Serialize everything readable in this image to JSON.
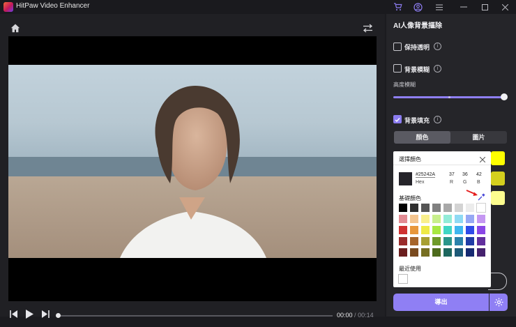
{
  "app": {
    "title": "HitPaw Video Enhancer"
  },
  "player": {
    "current_time": "00:00",
    "separator": "/",
    "total_time": "00:14"
  },
  "panel": {
    "title": "AI人像背景摳除",
    "keep_transparent": "保持透明",
    "bg_blur": "背景模糊",
    "blur_level": "高度模糊",
    "blur_value": 1.0,
    "bg_fill": "背景填充",
    "tabs": [
      "顏色",
      "圖片"
    ],
    "export": "導出"
  },
  "color_picker": {
    "title": "選擇顏色",
    "hex_value": "#25242A",
    "hex_label": "Hex",
    "r": "37",
    "g": "36",
    "b": "42",
    "r_label": "R",
    "g_label": "G",
    "b_label": "B",
    "basic_label": "基礎顏色",
    "recent_label": "最近使用",
    "current_color": "#25242a",
    "basic_colors": [
      [
        "#000000",
        "#2f2f2f",
        "#555555",
        "#808080",
        "#a8a8a8",
        "#d3d3d3",
        "#ececec",
        "#ffffff"
      ],
      [
        "#e28b93",
        "#f3c48e",
        "#f9ef8c",
        "#c8ef8c",
        "#92ecd8",
        "#8fdaf4",
        "#96a8f4",
        "#c597f2"
      ],
      [
        "#cf3131",
        "#e8973b",
        "#eeea46",
        "#a7e842",
        "#3fd6c4",
        "#3fb6ef",
        "#2f4be8",
        "#8a47e6"
      ],
      [
        "#9a2b2b",
        "#a7652a",
        "#a8a032",
        "#6f9b2a",
        "#29958a",
        "#2a81ab",
        "#203ca6",
        "#62309e"
      ],
      [
        "#6b1e1e",
        "#7a4b1f",
        "#776f22",
        "#4d6b1d",
        "#1d675f",
        "#1d5a78",
        "#162a72",
        "#45226e"
      ]
    ],
    "recent_colors": [
      "#ffffff"
    ]
  },
  "fill_swatches": [
    "#ffff00",
    "#d4cf1e",
    "#fdfd8f"
  ]
}
